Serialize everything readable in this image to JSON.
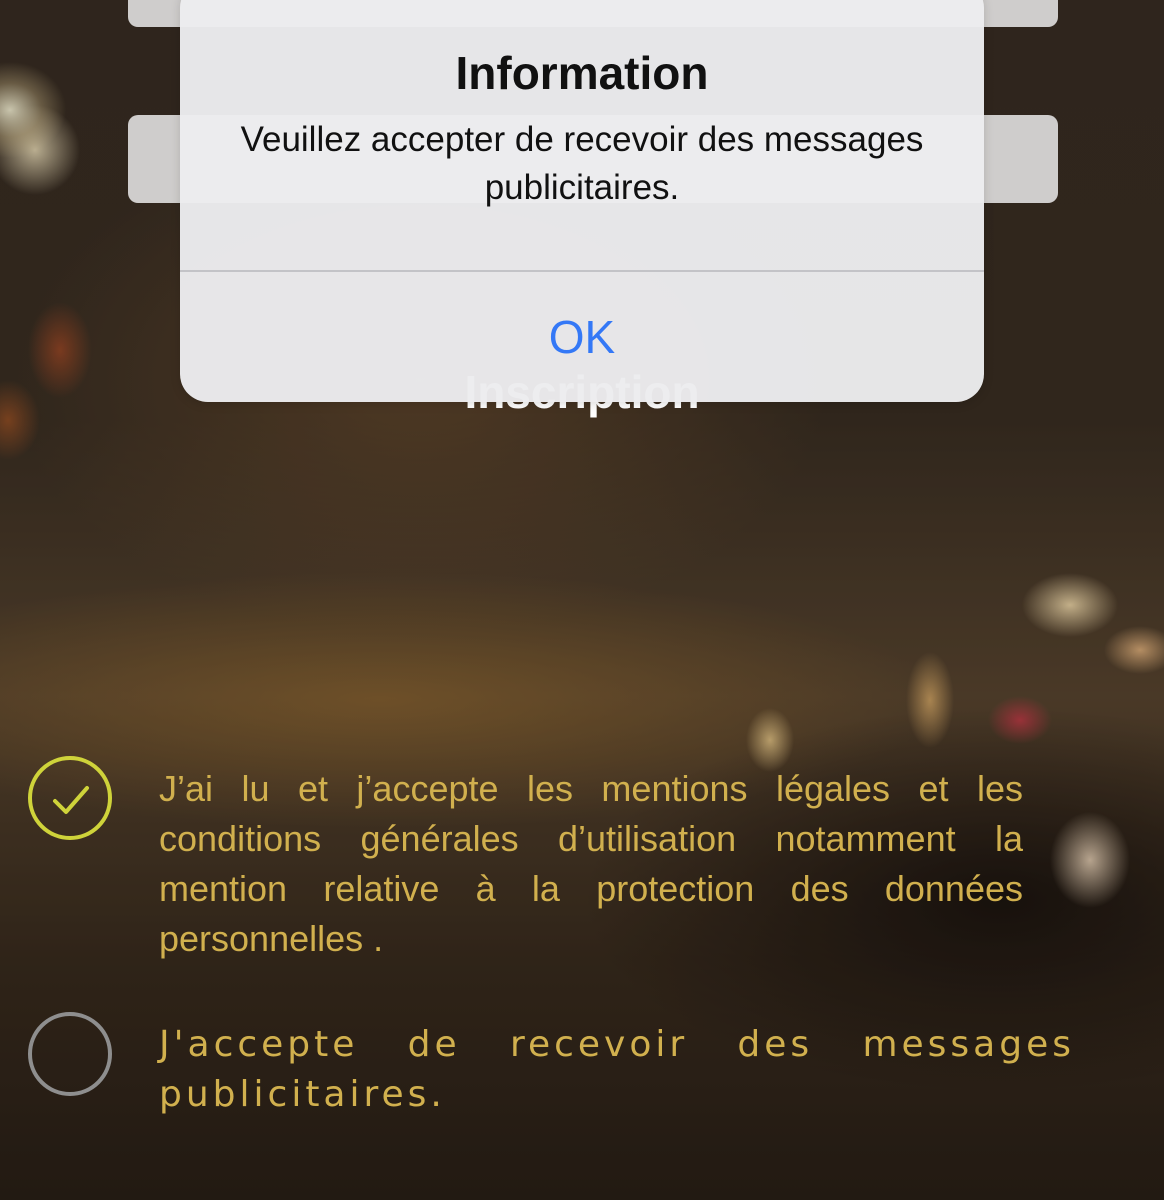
{
  "screen": {
    "title": "Inscription"
  },
  "consents": [
    {
      "text": "J’ai lu et j’accepte les mentions légales et les conditions générales d’utilisation notamment la mention relative à la protection des données personnelles .",
      "checked": true
    },
    {
      "text": "J'accepte de recevoir des messages publicitaires.",
      "checked": false
    }
  ],
  "alert": {
    "title": "Information",
    "message": "Veuillez accepter de recevoir des messages publicitaires.",
    "button": "OK"
  },
  "colors": {
    "accent_blue": "#3478f6",
    "consent_text": "#d1b04e",
    "check_ring": "#cfd33a",
    "unchecked_ring": "#8e8e8e"
  },
  "icons": {
    "checked": "checkmark-circle-icon",
    "unchecked": "empty-circle-icon"
  }
}
